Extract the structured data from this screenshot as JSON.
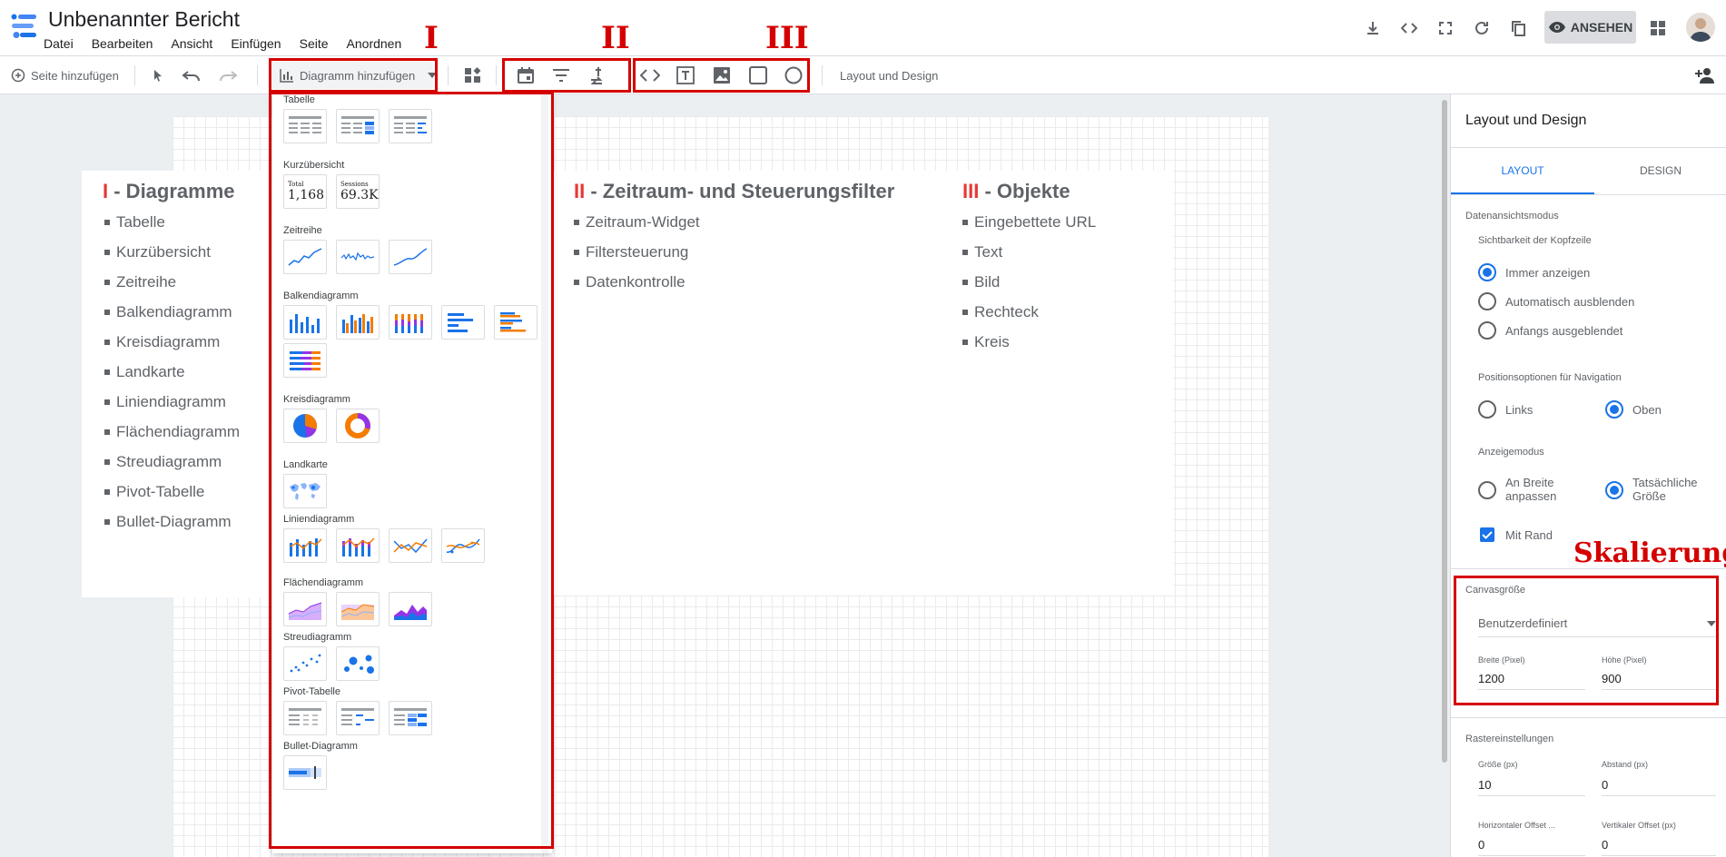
{
  "app": {
    "title": "Unbenannter Bericht",
    "menu": [
      "Datei",
      "Bearbeiten",
      "Ansicht",
      "Einfügen",
      "Seite",
      "Anordnen"
    ],
    "view_button": "ANSEHEN",
    "accent_color": "#1a73e8",
    "annotation_color": "#d50000"
  },
  "toolbar": {
    "add_page": "Seite hinzufügen",
    "add_chart": "Diagramm hinzufügen",
    "layout_design": "Layout und Design",
    "group_labels": [
      "I",
      "II",
      "III"
    ]
  },
  "dropdown": {
    "sections": [
      {
        "label": "Tabelle"
      },
      {
        "label": "Kurzübersicht"
      },
      {
        "label": "Zeitreihe"
      },
      {
        "label": "Balkendiagramm"
      },
      {
        "label": "Kreisdiagramm"
      },
      {
        "label": "Landkarte"
      },
      {
        "label": "Liniendiagramm"
      },
      {
        "label": "Flächendiagramm"
      },
      {
        "label": "Streudiagramm"
      },
      {
        "label": "Pivot-Tabelle"
      },
      {
        "label": "Bullet-Diagramm"
      }
    ],
    "scorecard": [
      {
        "title": "Total",
        "value": "1,168"
      },
      {
        "title": "Sessions",
        "value": "69.3K"
      }
    ]
  },
  "canvas": {
    "group1": {
      "numeral": "I",
      "title": " - Diagramme",
      "items": [
        "Tabelle",
        "Kurzübersicht",
        "Zeitreihe",
        "Balkendiagramm",
        "Kreisdiagramm",
        "Landkarte",
        "Liniendiagramm",
        "Flächendiagramm",
        "Streudiagramm",
        "Pivot-Tabelle",
        "Bullet-Diagramm"
      ]
    },
    "group2": {
      "numeral": "II",
      "title": " - Zeitraum- und Steuerungsfilter",
      "items": [
        "Zeitraum-Widget",
        "Filtersteuerung",
        "Datenkontrolle"
      ]
    },
    "group3": {
      "numeral": "III",
      "title": " - Objekte",
      "items": [
        "Eingebettete URL",
        "Text",
        "Bild",
        "Rechteck",
        "Kreis"
      ]
    }
  },
  "panel": {
    "title": "Layout und Design",
    "tabs": [
      "LAYOUT",
      "DESIGN"
    ],
    "active_tab": "LAYOUT",
    "data_view_mode": "Datenansichtsmodus",
    "header_visibility": "Sichtbarkeit der Kopfzeile",
    "header_options": [
      "Immer anzeigen",
      "Automatisch ausblenden",
      "Anfangs ausgeblendet"
    ],
    "header_selected": "Immer anzeigen",
    "nav_position": "Positionsoptionen für Navigation",
    "nav_options": [
      "Links",
      "Oben"
    ],
    "nav_selected": "Oben",
    "display_mode": "Anzeigemodus",
    "display_options": [
      "An Breite anpassen",
      "Tatsächliche Größe"
    ],
    "display_selected": "Tatsächliche Größe",
    "with_border": "Mit Rand",
    "with_border_checked": true,
    "scaling_label": "Skalierung",
    "canvas_size": "Canvasgröße",
    "canvas_size_value": "Benutzerdefiniert",
    "width_label": "Breite (Pixel)",
    "width_value": "1200",
    "height_label": "Höhe (Pixel)",
    "height_value": "900",
    "grid_settings": "Rastereinstellungen",
    "grid_size_label": "Größe (px)",
    "grid_size_value": "10",
    "spacing_label": "Abstand (px)",
    "spacing_value": "0",
    "h_offset_label": "Horizontaler Offset ...",
    "h_offset_value": "0",
    "v_offset_label": "Vertikaler Offset (px)",
    "v_offset_value": "0"
  }
}
